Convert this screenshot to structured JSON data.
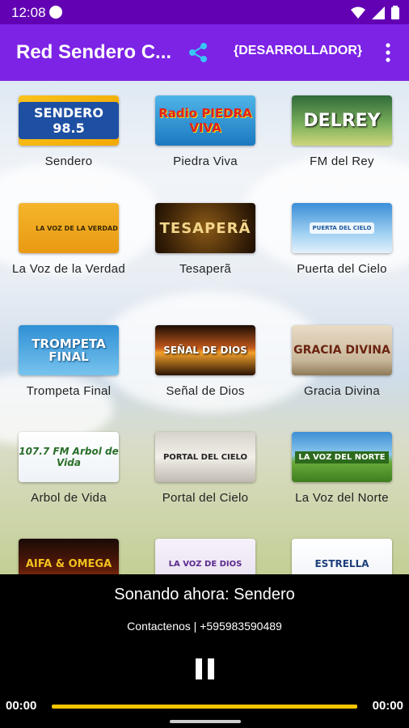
{
  "status_bar": {
    "time": "12:08"
  },
  "app_bar": {
    "title": "Red Sendero C...",
    "developer_label": "{DESARROLLADOR}"
  },
  "stations": [
    {
      "name": "Sendero",
      "logo_text": "SENDERO 98.5"
    },
    {
      "name": "Piedra Viva",
      "logo_text": "Radio PIEDRA VIVA"
    },
    {
      "name": "FM del Rey",
      "logo_text": "DELREY"
    },
    {
      "name": "La Voz de la Verdad",
      "logo_text": "LA VOZ DE LA VERDAD"
    },
    {
      "name": "Tesaperã",
      "logo_text": "TESAPERÃ"
    },
    {
      "name": "Puerta del Cielo",
      "logo_text": "PUERTA DEL CIELO"
    },
    {
      "name": "Trompeta Final",
      "logo_text": "TROMPETA FINAL"
    },
    {
      "name": "Señal de Dios",
      "logo_text": "SEÑAL DE DIOS"
    },
    {
      "name": "Gracia Divina",
      "logo_text": "GRACIA DIVINA"
    },
    {
      "name": "Arbol de Vida",
      "logo_text": "107.7 FM Arbol de Vida"
    },
    {
      "name": "Portal del Cielo",
      "logo_text": "PORTAL DEL CIELO"
    },
    {
      "name": "La Voz del Norte",
      "logo_text": "LA VOZ DEL NORTE"
    },
    {
      "name": "",
      "logo_text": "AIFA & OMEGA"
    },
    {
      "name": "",
      "logo_text": "LA VOZ DE DIOS"
    },
    {
      "name": "",
      "logo_text": "ESTRELLA"
    }
  ],
  "player": {
    "now_playing": "Sonando ahora: Sendero",
    "contact": "Contactenos | +595983590489",
    "elapsed": "00:00",
    "duration": "00:00"
  }
}
